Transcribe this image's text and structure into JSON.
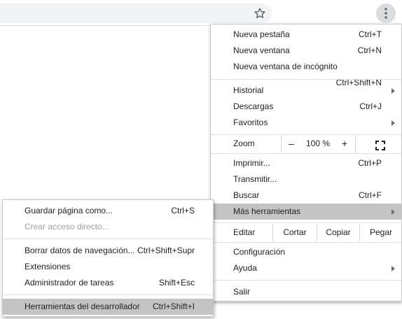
{
  "toolbar": {
    "icons": {
      "bookmark": "star-icon",
      "menu": "vertical-dots-icon"
    }
  },
  "main_menu": {
    "items": {
      "new_tab": {
        "label": "Nueva pestaña",
        "shortcut": "Ctrl+T"
      },
      "new_window": {
        "label": "Nueva ventana",
        "shortcut": "Ctrl+N"
      },
      "incognito": {
        "label": "Nueva ventana de incógnito",
        "shortcut": "Ctrl+Shift+N"
      },
      "history": {
        "label": "Historial"
      },
      "downloads": {
        "label": "Descargas",
        "shortcut": "Ctrl+J"
      },
      "bookmarks": {
        "label": "Favoritos"
      },
      "print": {
        "label": "Imprimir...",
        "shortcut": "Ctrl+P"
      },
      "cast": {
        "label": "Transmitir..."
      },
      "find": {
        "label": "Buscar",
        "shortcut": "Ctrl+F"
      },
      "more_tools": {
        "label": "Más herramientas"
      },
      "settings": {
        "label": "Configuración"
      },
      "help": {
        "label": "Ayuda"
      },
      "exit": {
        "label": "Salir"
      }
    },
    "zoom": {
      "label": "Zoom",
      "minus": "–",
      "value": "100 %",
      "plus": "+"
    },
    "edit": {
      "label": "Editar",
      "cut": "Cortar",
      "copy": "Copiar",
      "paste": "Pegar"
    }
  },
  "sub_menu": {
    "items": {
      "save_page": {
        "label": "Guardar página como...",
        "shortcut": "Ctrl+S"
      },
      "create_shortcut": {
        "label": "Crear acceso directo..."
      },
      "clear_data": {
        "label": "Borrar datos de navegación...",
        "shortcut": "Ctrl+Shift+Supr"
      },
      "extensions": {
        "label": "Extensiones"
      },
      "task_manager": {
        "label": "Administrador de tareas",
        "shortcut": "Shift+Esc"
      },
      "dev_tools": {
        "label": "Herramientas del desarrollador",
        "shortcut": "Ctrl+Shift+I"
      }
    }
  },
  "colors": {
    "highlight": "#c4c4c4",
    "disabled_text": "#a0a0a0",
    "menu_button_bg": "#dadce0"
  }
}
